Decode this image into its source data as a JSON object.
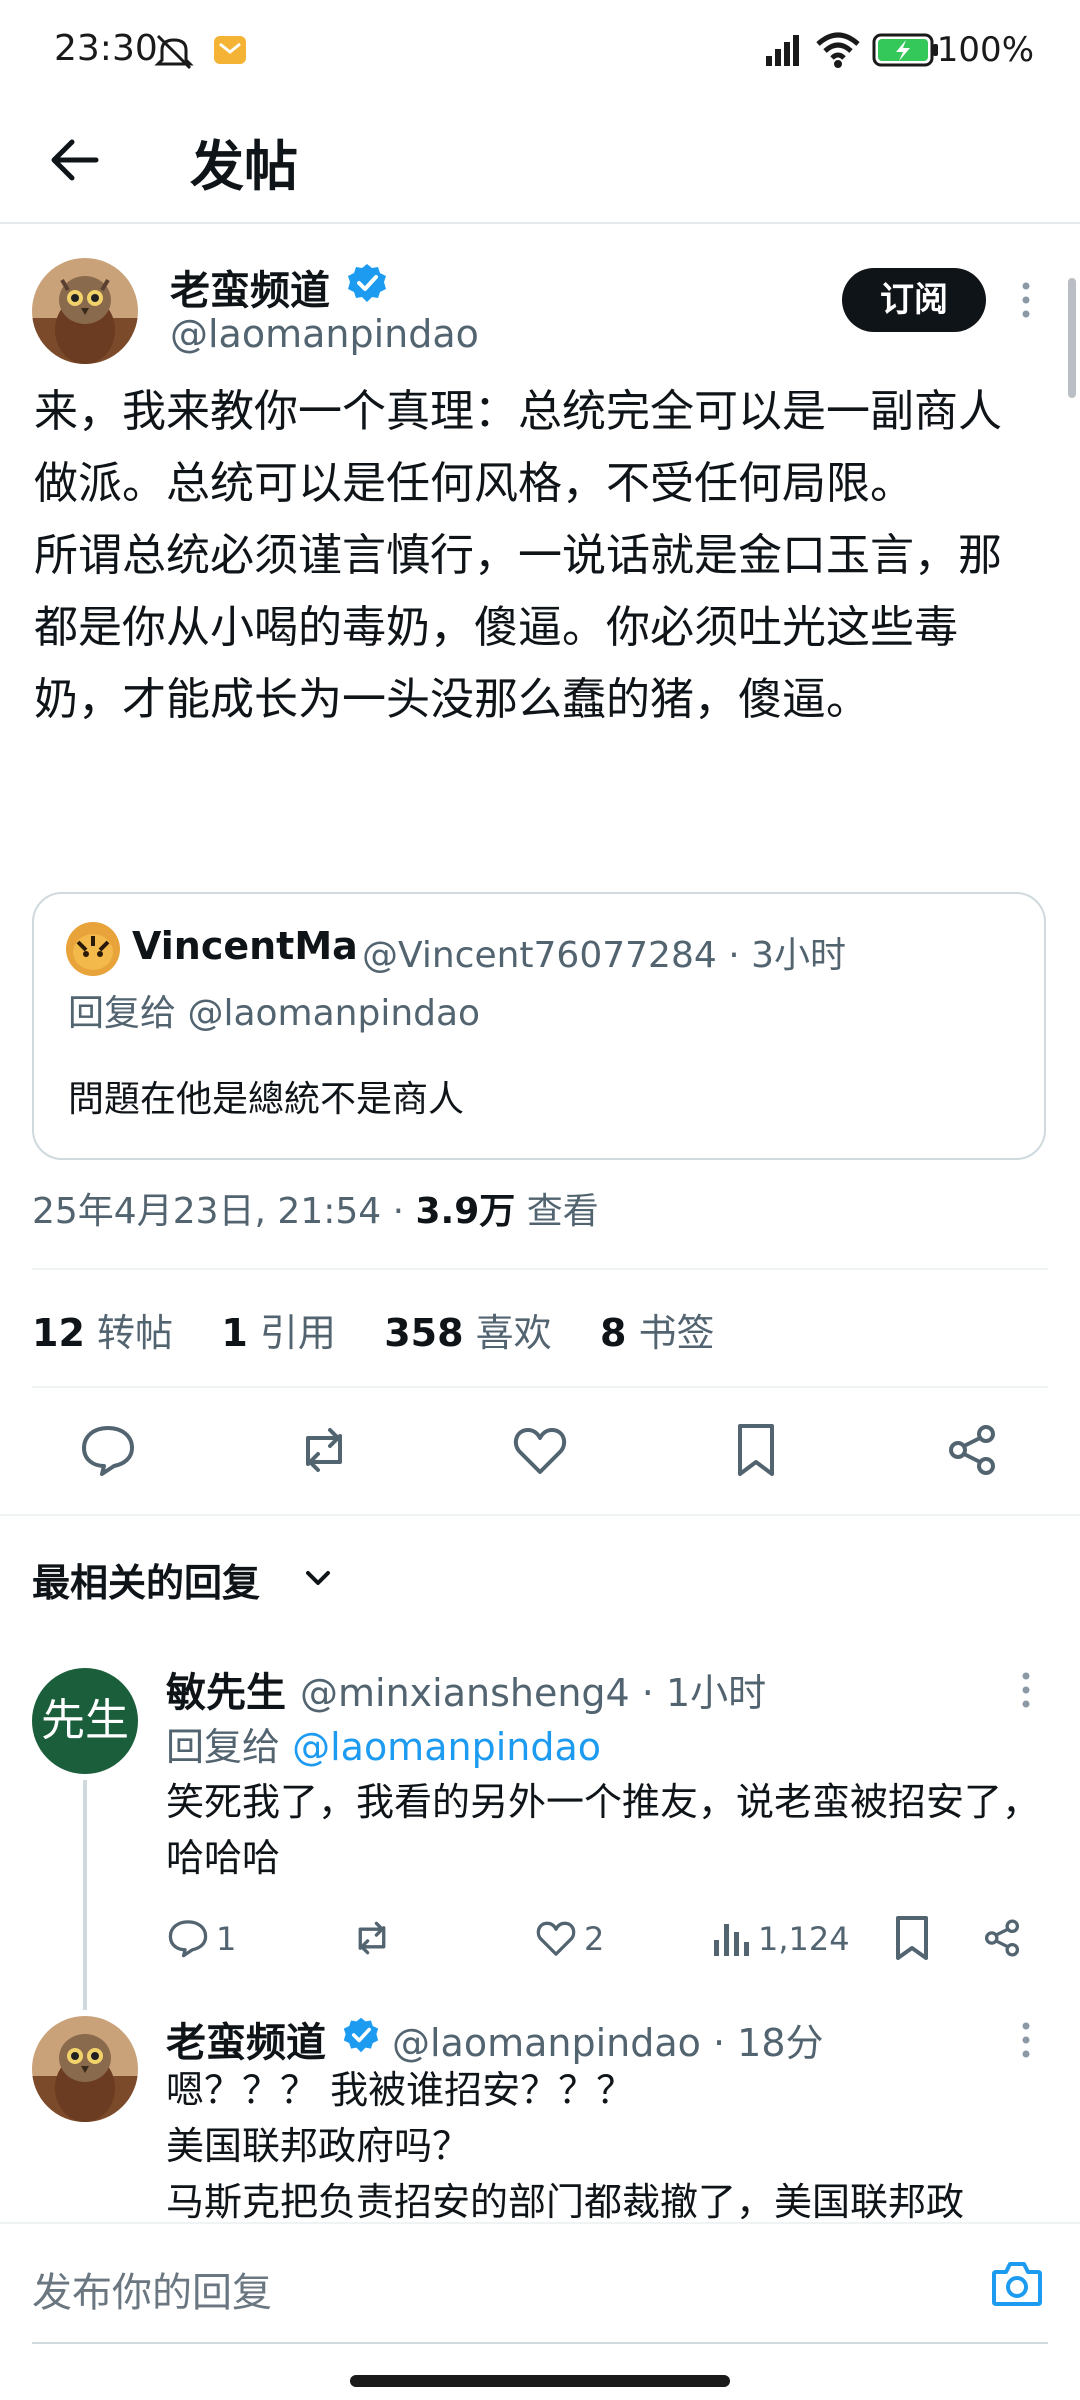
{
  "status_bar": {
    "time": "23:30",
    "battery": "100%"
  },
  "header": {
    "title": "发帖"
  },
  "post": {
    "author_name": "老蛮频道",
    "author_handle": "@laomanpindao",
    "subscribe_label": "订阅",
    "body_paragraphs": [
      "来，我来教你一个真理：总统完全可以是一副商人做派。总统可以是任何风格，不受任何局限。",
      "所谓总统必须谨言慎行，一说话就是金口玉言，那都是你从小喝的毒奶，傻逼。你必须吐光这些毒奶，才能成长为一头没那么蠢的猪，傻逼。"
    ],
    "quoted": {
      "author_name": "VincentMa",
      "author_meta": "@Vincent76077284 · 3小时",
      "reply_to": "回复给 @laomanpindao",
      "text": "問題在他是總統不是商人"
    },
    "timestamp": "25年4月23日, 21:54 · ",
    "views_count": "3.9万",
    "views_label": " 查看",
    "stats": [
      {
        "count": "12",
        "label": "转帖"
      },
      {
        "count": "1",
        "label": "引用"
      },
      {
        "count": "358",
        "label": "喜欢"
      },
      {
        "count": "8",
        "label": "书签"
      }
    ]
  },
  "replies_filter": {
    "label": "最相关的回复"
  },
  "replies": [
    {
      "avatar_text": "先生",
      "author_name": "敏先生",
      "meta": "@minxiansheng4 · 1小时",
      "reply_to_prefix": "回复给 ",
      "reply_to_handle": "@laomanpindao",
      "text": "笑死我了，我看的另外一个推友，说老蛮被招安了，哈哈哈",
      "reply_count": "1",
      "like_count": "2",
      "view_count": "1,124"
    },
    {
      "author_name": "老蛮频道",
      "meta": "@laomanpindao · 18分",
      "lines": [
        "嗯？？？ 我被谁招安？？？",
        "美国联邦政府吗？",
        "马斯克把负责招安的部门都裁撤了，美国联邦政"
      ]
    }
  ],
  "composer": {
    "placeholder": "发布你的回复"
  },
  "colors": {
    "accent": "#1d9bf0",
    "text": "#0f1419",
    "muted": "#536471",
    "border": "#cfd9de"
  }
}
